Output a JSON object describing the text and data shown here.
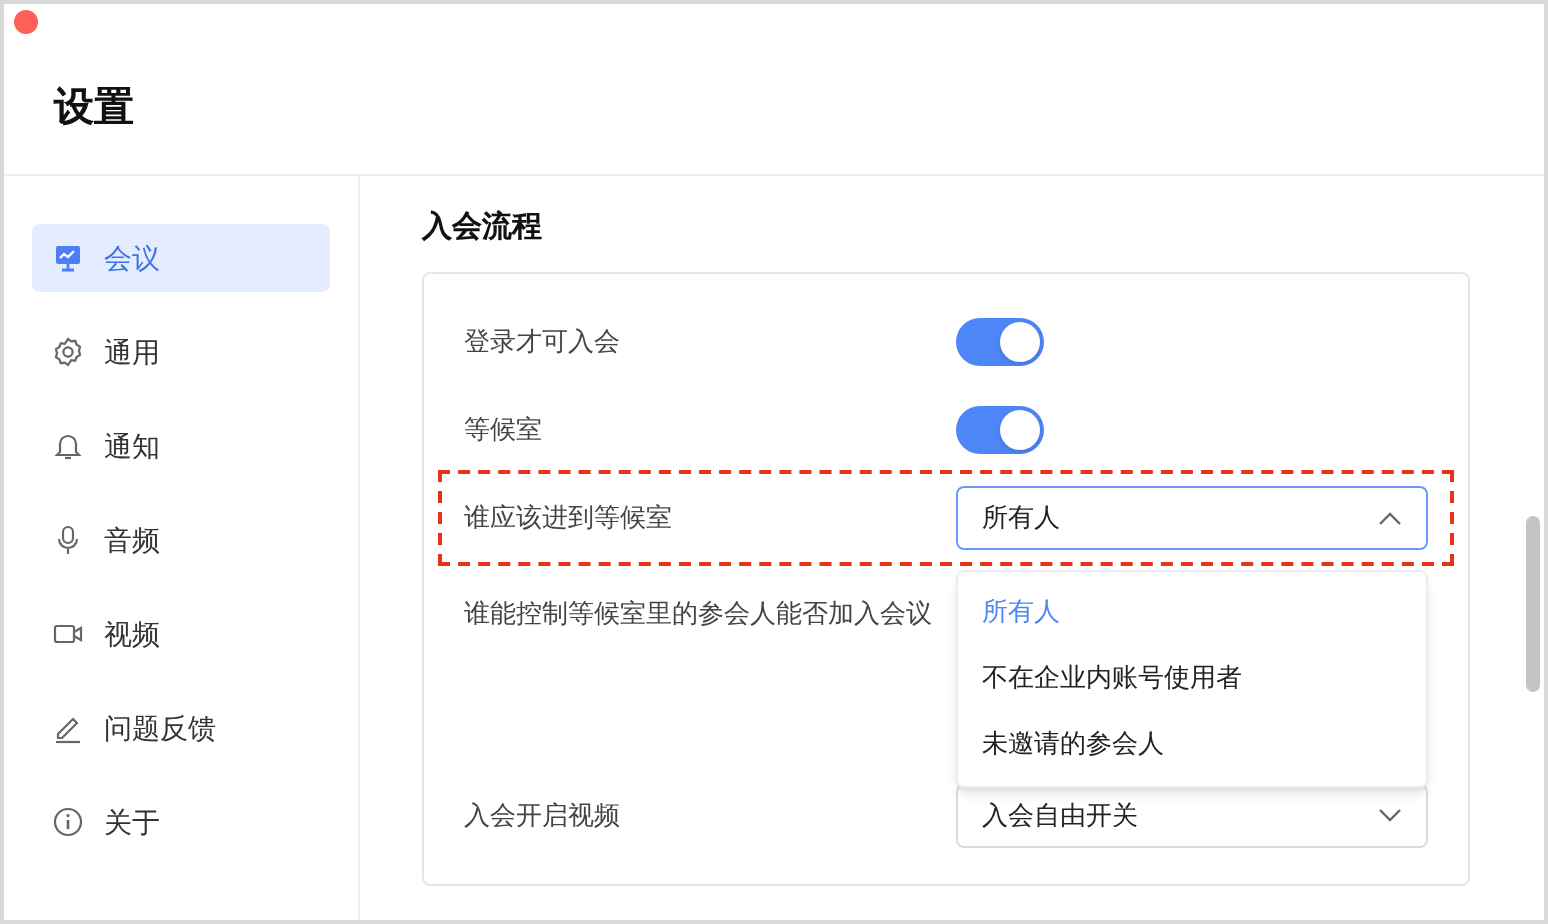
{
  "window": {
    "title": "设置"
  },
  "sidebar": {
    "items": [
      {
        "kind": "meeting",
        "label": "会议",
        "selected": true
      },
      {
        "kind": "gear",
        "label": "通用",
        "selected": false
      },
      {
        "kind": "bell",
        "label": "通知",
        "selected": false
      },
      {
        "kind": "mic",
        "label": "音频",
        "selected": false
      },
      {
        "kind": "camera",
        "label": "视频",
        "selected": false
      },
      {
        "kind": "pen",
        "label": "问题反馈",
        "selected": false
      },
      {
        "kind": "info",
        "label": "关于",
        "selected": false
      }
    ]
  },
  "section": {
    "heading": "入会流程",
    "rows": [
      {
        "kind": "toggle",
        "label": "登录才可入会",
        "on": true
      },
      {
        "kind": "toggle",
        "label": "等候室",
        "on": true
      },
      {
        "kind": "select",
        "label": "谁应该进到等候室",
        "value": "所有人",
        "expanded": true,
        "highlighted": true,
        "options": [
          {
            "label": "所有人",
            "selected": true
          },
          {
            "label": "不在企业内账号使用者",
            "selected": false
          },
          {
            "label": "未邀请的参会人",
            "selected": false
          }
        ]
      },
      {
        "kind": "text",
        "label": "谁能控制等候室里的参会人能否加入会议"
      },
      {
        "kind": "select",
        "label": "入会开启视频",
        "value": "入会自由开关",
        "expanded": false,
        "highlighted": false
      }
    ]
  }
}
